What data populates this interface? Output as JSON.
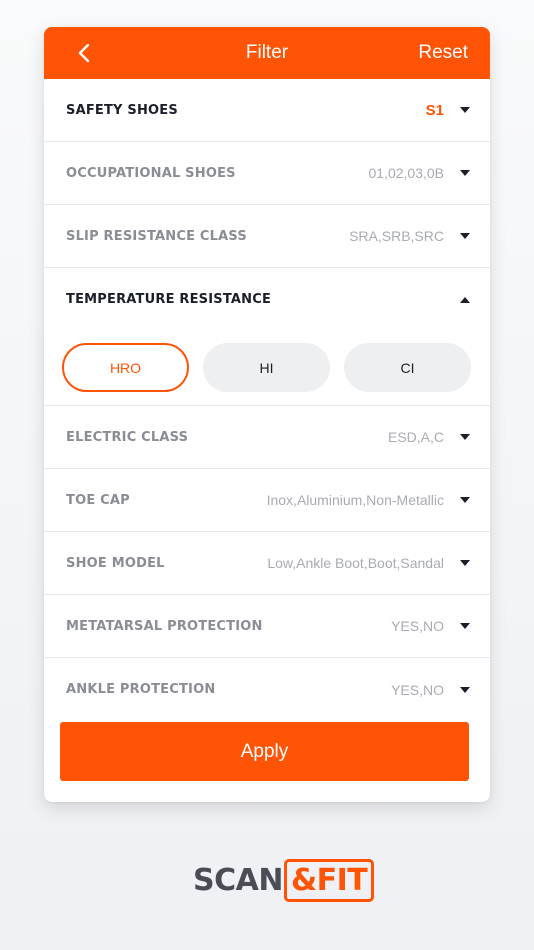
{
  "header": {
    "title": "Filter",
    "reset_label": "Reset"
  },
  "filters": [
    {
      "label": "SAFETY SHOES",
      "value": "S1"
    },
    {
      "label": "OCCUPATIONAL SHOES",
      "value": "01,02,03,0B"
    },
    {
      "label": "SLIP RESISTANCE CLASS",
      "value": "SRA,SRB,SRC"
    },
    {
      "label": "TEMPERATURE RESISTANCE",
      "value": ""
    },
    {
      "label": "ELECTRIC CLASS",
      "value": "ESD,A,C"
    },
    {
      "label": "TOE CAP",
      "value": "Inox,Aluminium,Non-Metallic"
    },
    {
      "label": "SHOE MODEL",
      "value": "Low,Ankle Boot,Boot,Sandal"
    },
    {
      "label": "METATARSAL PROTECTION",
      "value": "YES,NO"
    },
    {
      "label": "ANKLE PROTECTION",
      "value": "YES,NO"
    }
  ],
  "temperature_options": [
    {
      "label": "HRO",
      "selected": true
    },
    {
      "label": "HI",
      "selected": false
    },
    {
      "label": "CI",
      "selected": false
    }
  ],
  "apply_label": "Apply",
  "logo": {
    "left": "SCAN",
    "right": "&FIT"
  },
  "colors": {
    "accent": "#ff5306",
    "dark": "#1b1f2a",
    "muted": "#8a8d94"
  },
  "icons": {
    "back": "chevron-left-icon",
    "dropdown": "caret-down-icon",
    "collapse": "caret-up-icon"
  }
}
